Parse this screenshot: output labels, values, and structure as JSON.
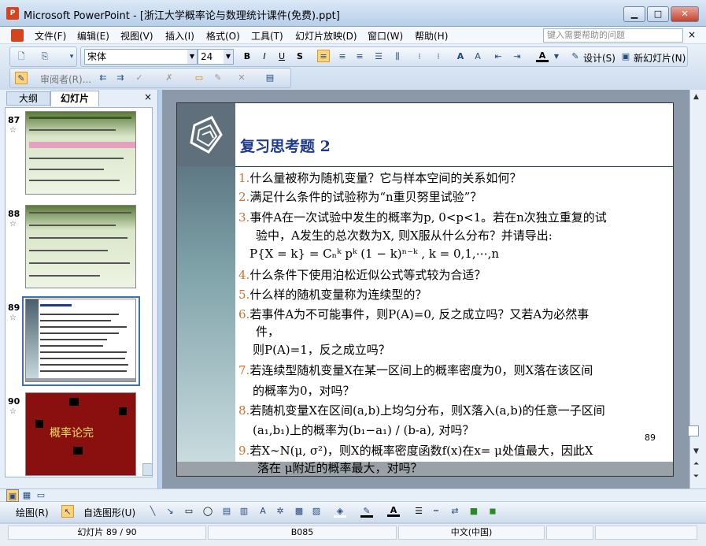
{
  "window": {
    "title": "Microsoft PowerPoint - [浙江大学概率论与数理统计课件(免费).ppt]",
    "app_icon": "P"
  },
  "menu": [
    "文件(F)",
    "编辑(E)",
    "视图(V)",
    "插入(I)",
    "格式(O)",
    "工具(T)",
    "幻灯片放映(D)",
    "窗口(W)",
    "帮助(H)"
  ],
  "help_placeholder": "键入需要帮助的问题",
  "toolbar": {
    "font_name": "宋体",
    "font_size": "24",
    "bold": "B",
    "italic": "I",
    "underline": "U",
    "shadow": "S",
    "design": "设计(S)",
    "new_slide": "新幻灯片(N)",
    "reviewer": "审阅者(R)..."
  },
  "left_pane": {
    "tab_outline": "大纲",
    "tab_slides": "幻灯片",
    "close": "×"
  },
  "thumbnails": [
    {
      "num": "87"
    },
    {
      "num": "88"
    },
    {
      "num": "89"
    },
    {
      "num": "90",
      "text": "概率论完"
    }
  ],
  "slide": {
    "title": "复习思考题 2",
    "page_number": "89",
    "questions": [
      {
        "n": "1.",
        "text": "什么量被称为随机变量？它与样本空间的关系如何？"
      },
      {
        "n": "2.",
        "text": "满足什么条件的试验称为“n重贝努里试验”？"
      },
      {
        "n": "3.",
        "text": "事件A在一次试验中发生的概率为p, 0<p<1。若在n次独立重复的试",
        "cont": "验中，A发生的总次数为X, 则X服从什么分布？并请导出:"
      },
      {
        "formula": "P{X = k} = Cₙᵏ pᵏ (1 − k)ⁿ⁻ᵏ ,  k = 0,1,⋯,n"
      },
      {
        "n": "4.",
        "text": "什么条件下使用泊松近似公式等式较为合适？"
      },
      {
        "n": "5.",
        "text": "什么样的随机变量称为连续型的？"
      },
      {
        "n": "6.",
        "text": "若事件A为不可能事件，则P(A)=0, 反之成立吗？又若A为必然事",
        "cont": "件，",
        "cont2": "则P(A)=1，反之成立吗？"
      },
      {
        "n": "7.",
        "text": "若连续型随机变量X在某一区间上的概率密度为0，则X落在该区间",
        "cont": "的概率为0，对吗？"
      },
      {
        "n": "8.",
        "text": "若随机变量X在区间(a,b)上均匀分布，则X落入(a,b)的任意一子区间",
        "cont": "(a₁,b₁)上的概率为(b₁−a₁) / (b-a), 对吗？"
      },
      {
        "n": "9.",
        "text": "若X∼N(μ, σ²)，则X的概率密度函数f(x)在x= μ处值最大，因此X",
        "cont": "落在 μ附近的概率最大，对吗？"
      }
    ]
  },
  "drawbar": {
    "draw": "绘图(R)",
    "autoshapes": "自选图形(U)"
  },
  "status": {
    "slide": "幻灯片 89 / 90",
    "design": "B085",
    "lang": "中文(中国)"
  }
}
